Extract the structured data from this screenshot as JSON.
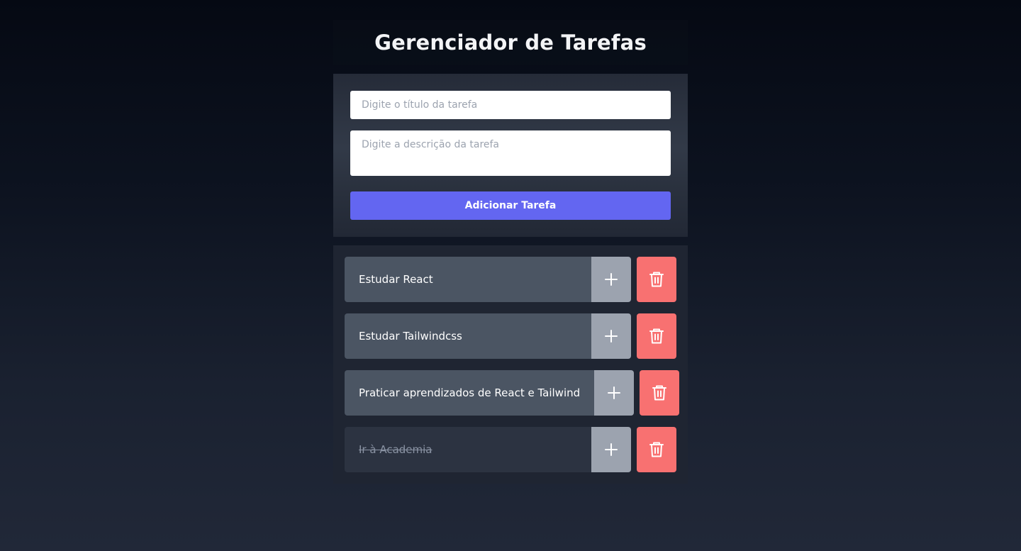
{
  "header": {
    "title": "Gerenciador de Tarefas"
  },
  "form": {
    "title_placeholder": "Digite o título da tarefa",
    "title_value": "",
    "description_placeholder": "Digite a descrição da tarefa",
    "description_value": "",
    "submit_label": "Adicionar Tarefa"
  },
  "tasks": [
    {
      "title": "Estudar React",
      "completed": false,
      "details_icon": "plus-icon",
      "delete_icon": "trash-icon"
    },
    {
      "title": "Estudar Tailwindcss",
      "completed": false,
      "details_icon": "plus-icon",
      "delete_icon": "trash-icon"
    },
    {
      "title": "Praticar aprendizados de React e Tailwind",
      "completed": false,
      "details_icon": "plus-icon",
      "delete_icon": "trash-icon"
    },
    {
      "title": "Ir à Academia",
      "completed": true,
      "details_icon": "plus-icon",
      "delete_icon": "trash-icon"
    }
  ],
  "colors": {
    "accent": "#6366f1",
    "delete": "#f87171",
    "task_bg": "#4b5563",
    "task_done_bg": "#2c3341",
    "details_bg": "#9ca3af"
  }
}
